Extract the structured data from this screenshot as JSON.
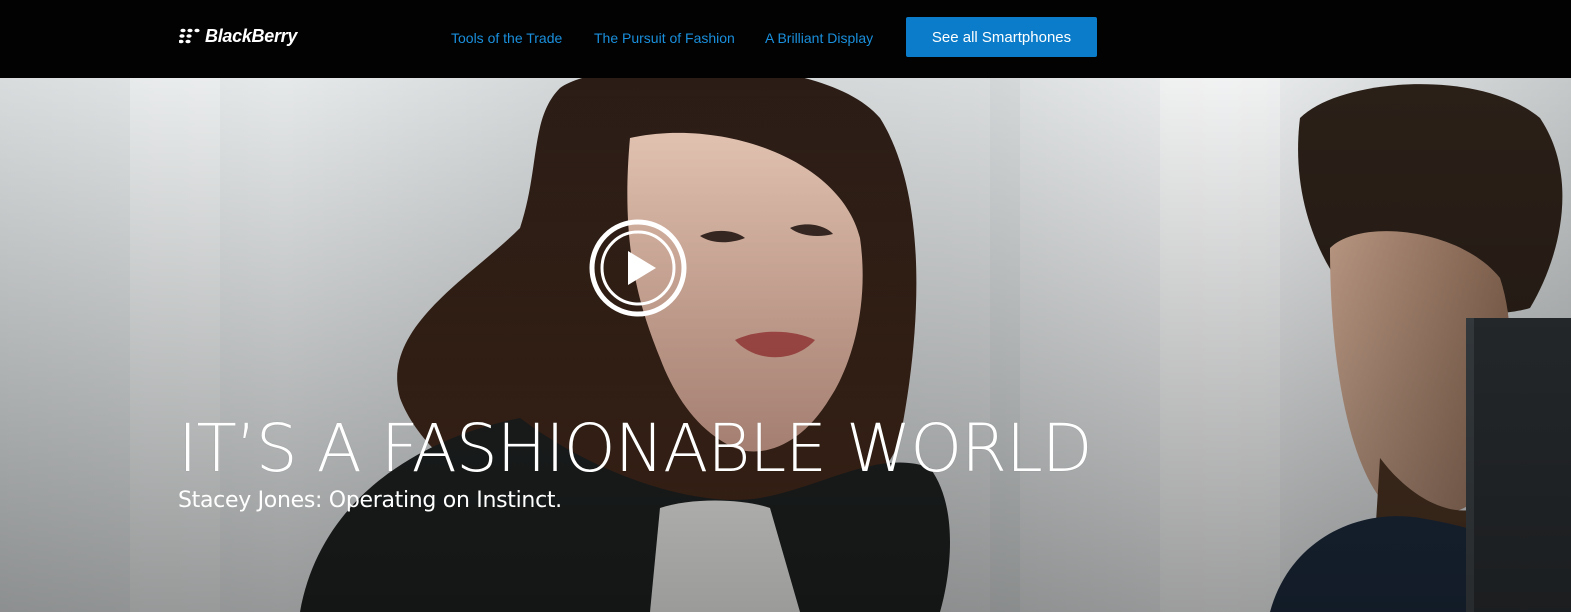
{
  "header": {
    "logo_text": "BlackBerry",
    "logo_icon": "blackberry-logo-icon",
    "nav": [
      {
        "label": "Tools of the Trade"
      },
      {
        "label": "The Pursuit of Fashion"
      },
      {
        "label": "A Brilliant Display"
      }
    ],
    "cta_label": "See all Smartphones"
  },
  "hero": {
    "headline": "IT’S A FASHIONABLE WORLD",
    "subline": "Stacey Jones: Operating on Instinct.",
    "play_icon": "play-icon"
  },
  "colors": {
    "topbar": "#020202",
    "nav_link": "#1a8fdc",
    "cta_bg": "#0a7cc9",
    "text_on_hero": "#ffffff"
  }
}
